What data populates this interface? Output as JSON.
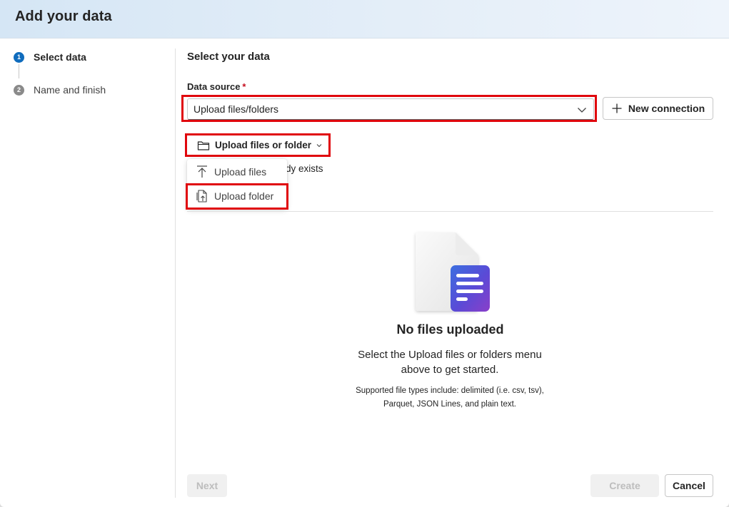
{
  "header": {
    "title": "Add your data"
  },
  "stepper": {
    "steps": [
      {
        "number": "1",
        "label": "Select data",
        "active": true
      },
      {
        "number": "2",
        "label": "Name and finish",
        "active": false
      }
    ]
  },
  "main": {
    "section_title": "Select your data",
    "data_source": {
      "label": "Data source",
      "required_mark": "*",
      "value": "Upload files/folders"
    },
    "new_connection_label": "New connection",
    "upload_button_label": "Upload files or folder",
    "partial_hidden_text": "dy exists",
    "upload_menu": [
      {
        "label": "Upload files",
        "icon": "arrow-up-icon"
      },
      {
        "label": "Upload folder",
        "icon": "folder-upload-icon"
      }
    ],
    "empty_state": {
      "title": "No files uploaded",
      "description": "Select the Upload files or folders menu above to get started.",
      "note": "Supported file types include: delimited (i.e. csv, tsv), Parquet, JSON Lines, and plain text."
    }
  },
  "footer": {
    "next_label": "Next",
    "create_label": "Create",
    "cancel_label": "Cancel"
  },
  "colors": {
    "accent": "#0f6cbd",
    "highlight": "#e0070d",
    "required": "#c50f1f"
  }
}
